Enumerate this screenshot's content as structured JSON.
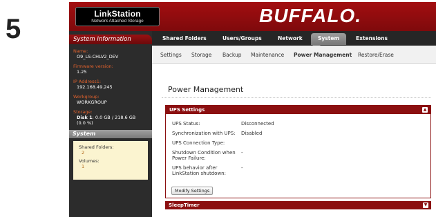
{
  "step": "5",
  "brand": {
    "title": "LinkStation",
    "subtitle": "Network Attached Storage"
  },
  "logo": "BUFFALO.",
  "sidebar": {
    "system_info_title": "System Information",
    "name_label": "Name:",
    "name_value": "O9_LS-CHLV2_DEV",
    "firmware_label": "Firmware version:",
    "firmware_value": "1.25",
    "ip_label": "IP Address1:",
    "ip_value": "192.168.49.245",
    "workgroup_label": "Workgroup:",
    "workgroup_value": "WORKGROUP",
    "storage_label": "Storage:",
    "storage_disk": "Disk 1",
    "storage_value": ": 0.0 GB / 218.6 GB",
    "storage_pct": "(0.0 %)",
    "system_title": "System",
    "shared_folders_label": "Shared Folders:",
    "shared_folders_value": "2",
    "volumes_label": "Volumes:",
    "volumes_value": "1"
  },
  "nav": {
    "shared_folders": "Shared Folders",
    "users_groups": "Users/Groups",
    "network": "Network",
    "system": "System",
    "extensions": "Extensions"
  },
  "subnav": {
    "settings": "Settings",
    "storage": "Storage",
    "backup": "Backup",
    "maintenance": "Maintenance",
    "power_management": "Power Management",
    "restore_erase": "Restore/Erase"
  },
  "main": {
    "title": "Power Management",
    "ups_panel": {
      "title": "UPS Settings",
      "ups_status_label": "UPS Status:",
      "ups_status_value": "Disconnected",
      "sync_label": "Synchronization with UPS:",
      "sync_value": "Disabled",
      "conn_type_label": "UPS Connection Type:",
      "shutdown_label_1": "Shutdown Condition when",
      "shutdown_label_2": "Power Failure:",
      "shutdown_value": "-",
      "behavior_label_1": "UPS behavior after",
      "behavior_label_2": "LinkStation shutdown:",
      "behavior_value": "-",
      "modify_button": "Modify Settings"
    },
    "sleep_panel": {
      "title": "SleepTimer"
    }
  },
  "colors": {
    "accent": "#8b0f10",
    "sidebar_label": "#e0612c",
    "nav_bg": "#262626"
  }
}
